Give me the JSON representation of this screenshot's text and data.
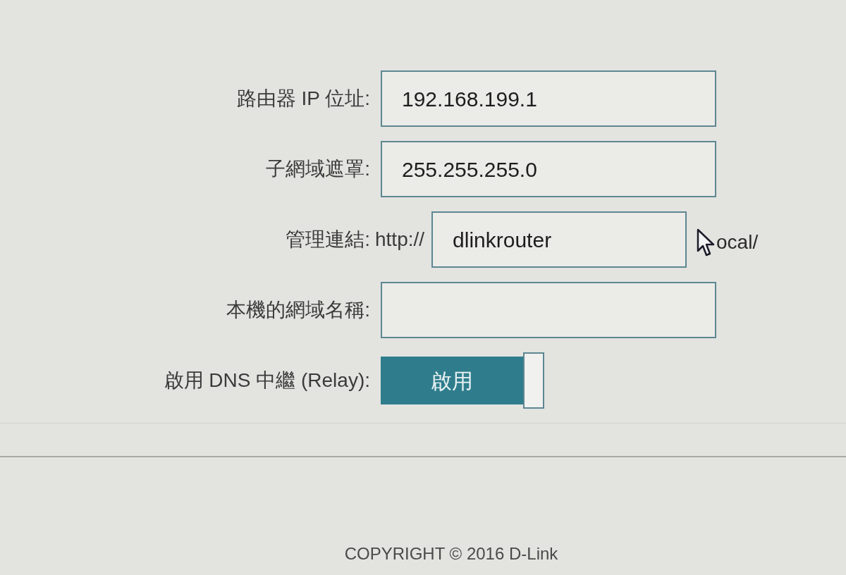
{
  "fields": [
    {
      "kind": "text",
      "label": "路由器 IP 位址:",
      "value": "192.168.199.1"
    },
    {
      "kind": "text",
      "label": "子網域遮罩:",
      "value": "255.255.255.0"
    },
    {
      "kind": "url",
      "label": "管理連結:",
      "prefix": "http://",
      "value": "dlinkrouter",
      "suffix": "ocal/"
    },
    {
      "kind": "text",
      "label": "本機的網域名稱:"
    },
    {
      "kind": "toggle",
      "label": "啟用 DNS 中繼 (Relay):",
      "text": "啟用",
      "on": true
    }
  ],
  "footer": {
    "copyright": "COPYRIGHT © 2016 D-Link"
  }
}
